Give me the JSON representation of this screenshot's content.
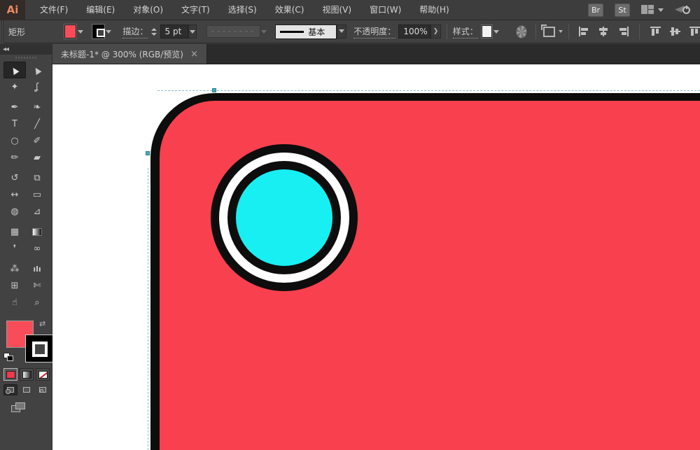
{
  "app": {
    "logo": "Ai"
  },
  "menu_bar": {
    "items": [
      "文件(F)",
      "编辑(E)",
      "对象(O)",
      "文字(T)",
      "选择(S)",
      "效果(C)",
      "视图(V)",
      "窗口(W)",
      "帮助(H)"
    ],
    "bridge_button": "Br",
    "stock_button": "St"
  },
  "control_bar": {
    "selected_object": "矩形",
    "stroke_label": "描边：",
    "stroke_value": "5 pt",
    "brush_value": "基本",
    "opacity_label": "不透明度：",
    "opacity_value": "100%",
    "opacity_more": "❯",
    "style_label": "样式："
  },
  "document_tab": {
    "title": "未标题-1* @ 300% (RGB/预览)",
    "close": "×"
  },
  "toolbar": {
    "collapse": "◂◂",
    "swap_glyph": "⇄",
    "tools": [
      {
        "name": "selection-tool",
        "glyph": "▲",
        "rot": true,
        "selected": true
      },
      {
        "name": "direct-selection-tool",
        "glyph": "▲",
        "rot": true
      },
      {
        "name": "magic-wand-tool",
        "glyph": "✦"
      },
      {
        "name": "lasso-tool",
        "glyph": "ʆ"
      },
      {
        "name": "pen-tool",
        "glyph": "✒"
      },
      {
        "name": "blob-brush-tool",
        "glyph": "❧"
      },
      {
        "name": "type-tool",
        "glyph": "T"
      },
      {
        "name": "line-segment-tool",
        "glyph": "╱"
      },
      {
        "name": "ellipse-tool",
        "glyph": "○"
      },
      {
        "name": "paintbrush-tool",
        "glyph": "✐"
      },
      {
        "name": "pencil-tool",
        "glyph": "✏"
      },
      {
        "name": "eraser-tool",
        "glyph": "▰"
      },
      {
        "name": "rotate-tool",
        "glyph": "↺"
      },
      {
        "name": "scale-tool",
        "glyph": "⧉"
      },
      {
        "name": "width-tool",
        "glyph": "↔"
      },
      {
        "name": "free-transform-tool",
        "glyph": "▭"
      },
      {
        "name": "shape-builder-tool",
        "glyph": "◍"
      },
      {
        "name": "perspective-grid-tool",
        "glyph": "⊿"
      },
      {
        "name": "mesh-tool",
        "glyph": "▦"
      },
      {
        "name": "gradient-tool",
        "glyph": "",
        "swatch": "gradient"
      },
      {
        "name": "eyedropper-tool",
        "glyph": "❜"
      },
      {
        "name": "blend-tool",
        "glyph": "∞"
      },
      {
        "name": "symbol-sprayer-tool",
        "glyph": "⁂"
      },
      {
        "name": "column-graph-tool",
        "glyph": "ılı",
        "bars": true
      },
      {
        "name": "artboard-tool",
        "glyph": "⊞"
      },
      {
        "name": "slice-tool",
        "glyph": "✄"
      },
      {
        "name": "hand-tool",
        "glyph": "☝"
      },
      {
        "name": "zoom-tool",
        "glyph": "⌕"
      }
    ]
  },
  "colors": {
    "artwork_red": "#F8404E",
    "artwork_cyan": "#18EFF2",
    "artwork_stroke": "#0D0D0D",
    "anchor_teal": "#4BADB5",
    "fill_swatch_red": "#F94C59",
    "ui_dark": "#3D3D3D",
    "tab_strip": "#2B2B2B"
  }
}
